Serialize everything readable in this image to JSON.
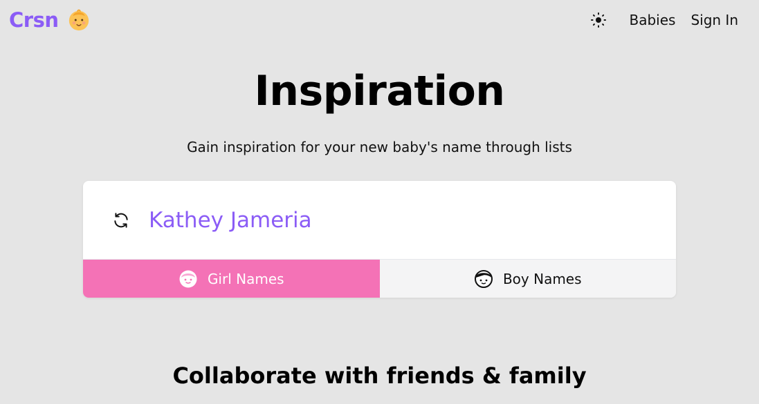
{
  "header": {
    "brand": "Crsn",
    "brand_icon": "baby-emoji-icon",
    "theme_icon": "sun-icon",
    "nav": [
      {
        "label": "Babies"
      },
      {
        "label": "Sign In"
      }
    ]
  },
  "hero": {
    "title": "Inspiration",
    "subtitle": "Gain inspiration for your new baby's name through lists"
  },
  "generator": {
    "refresh_icon": "refresh-icon",
    "current_name": "Kathey Jameria",
    "tabs": [
      {
        "label": "Girl Names",
        "icon": "girl-face-icon",
        "active": true
      },
      {
        "label": "Boy Names",
        "icon": "boy-face-icon",
        "active": false
      }
    ]
  },
  "section": {
    "title": "Collaborate with friends & family"
  },
  "colors": {
    "brand": "#8b5cf6",
    "girl_tab": "#f472b6",
    "boy_tab": "#f4f4f5",
    "background": "#e5e5e5"
  }
}
